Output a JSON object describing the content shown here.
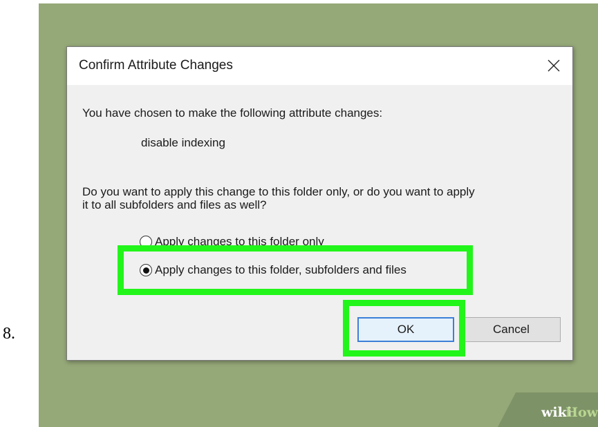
{
  "step_number": "8.",
  "dialog": {
    "title": "Confirm Attribute Changes",
    "intro": "You have chosen to make the following attribute changes:",
    "change": "disable indexing",
    "question_line1": "Do you want to apply this change to this folder only, or do you want to apply",
    "question_line2": "it to all subfolders and files as well?",
    "options": [
      {
        "label": "Apply changes to this folder only",
        "selected": false
      },
      {
        "label": "Apply changes to this folder, subfolders and files",
        "selected": true
      }
    ],
    "ok_label": "OK",
    "cancel_label": "Cancel"
  },
  "watermark": {
    "wiki": "wiki",
    "how": "How"
  },
  "colors": {
    "background": "#95a878",
    "highlight": "#22f51a",
    "dialog_body": "#f0f0f0",
    "default_button_border": "#3c7fd8"
  },
  "icons": {
    "close": "close-icon"
  }
}
